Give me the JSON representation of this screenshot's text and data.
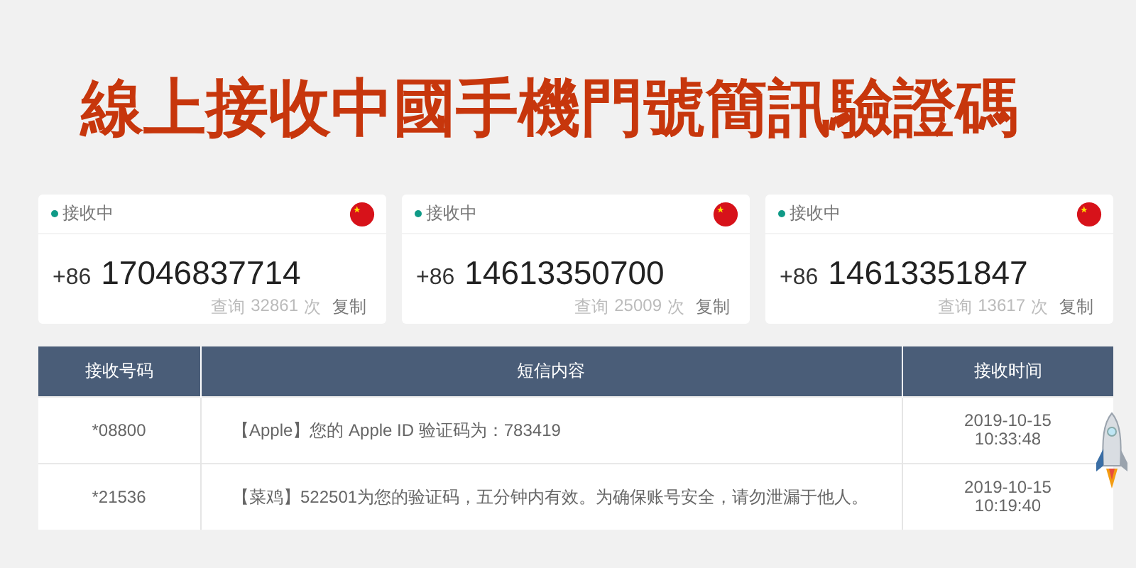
{
  "title": "線上接收中國手機門號簡訊驗證碼",
  "numbers": [
    {
      "status": "接收中",
      "receiving": true,
      "prefix": "+86",
      "number": "17046837714",
      "query_label": "查询",
      "count": "32861",
      "count_unit": "次",
      "copy": "复制"
    },
    {
      "status": "接收中",
      "receiving": true,
      "prefix": "+86",
      "number": "14613350700",
      "query_label": "查询",
      "count": "25009",
      "count_unit": "次",
      "copy": "复制"
    },
    {
      "status": "接收中",
      "receiving": true,
      "prefix": "+86",
      "number": "14613351847",
      "query_label": "查询",
      "count": "13617",
      "count_unit": "次",
      "copy": "复制"
    }
  ],
  "table": {
    "columns": [
      "接收号码",
      "短信内容",
      "接收时间"
    ],
    "rows": [
      {
        "sender": "*08800",
        "content": "【Apple】您的 Apple ID 验证码为：783419",
        "date": "2019-10-15",
        "time": "10:33:48"
      },
      {
        "sender": "*21536",
        "content": "【菜鸡】522501为您的验证码，五分钟内有效。为确保账号安全，请勿泄漏于他人。",
        "date": "2019-10-15",
        "time": "10:19:40"
      }
    ]
  }
}
